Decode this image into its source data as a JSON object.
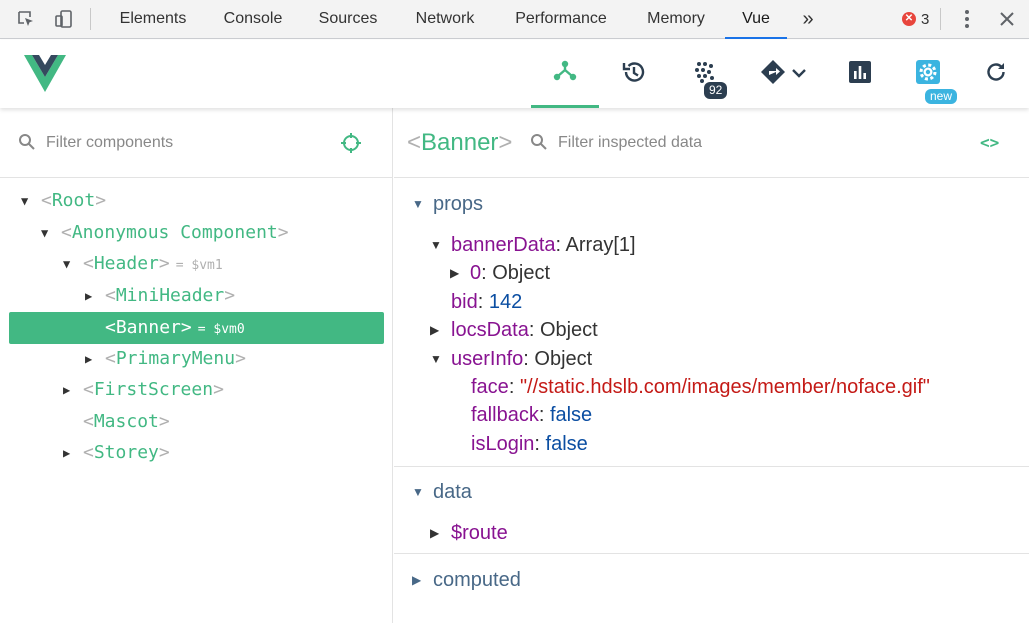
{
  "devtools": {
    "tabs": [
      "Elements",
      "Console",
      "Sources",
      "Network",
      "Performance",
      "Memory",
      "Vue"
    ],
    "more": "»",
    "error_count": "3",
    "accent": "#1a73e8"
  },
  "vue_toolbar": {
    "tools": [
      {
        "name": "components",
        "icon": "component-tree-icon",
        "active": true
      },
      {
        "name": "vuex",
        "icon": "history-icon"
      },
      {
        "name": "events",
        "icon": "events-dots-icon",
        "badge": "92"
      },
      {
        "name": "routing",
        "icon": "route-icon"
      },
      {
        "name": "performance",
        "icon": "bar-chart-icon"
      },
      {
        "name": "settings",
        "icon": "gear-icon",
        "badge": "new"
      },
      {
        "name": "refresh",
        "icon": "refresh-icon"
      }
    ],
    "events_badge": "92",
    "settings_badge": "new",
    "brand": "#42b883"
  },
  "components": {
    "filter_placeholder": "Filter components",
    "tree": [
      {
        "name": "Root",
        "expanded": true
      },
      {
        "name": "Anonymous Component",
        "expanded": true
      },
      {
        "name": "Header",
        "vm": "= $vm1",
        "expanded": true
      },
      {
        "name": "MiniHeader",
        "collapsed": true
      },
      {
        "name": "Banner",
        "vm": "= $vm0",
        "selected": true
      },
      {
        "name": "PrimaryMenu",
        "collapsed": true
      },
      {
        "name": "FirstScreen",
        "collapsed": true
      },
      {
        "name": "Mascot"
      },
      {
        "name": "Storey",
        "collapsed": true
      }
    ]
  },
  "inspector": {
    "component_name": "Banner",
    "filter_placeholder": "Filter inspected data",
    "code_icon": "<>",
    "sections": {
      "props": {
        "label": "props",
        "rows": {
          "bannerData": {
            "key": "bannerData",
            "value": "Array[1]"
          },
          "item0": {
            "key": "0",
            "value": "Object"
          },
          "bid": {
            "key": "bid",
            "value": "142"
          },
          "locsData": {
            "key": "locsData",
            "value": "Object"
          },
          "userInfo": {
            "key": "userInfo",
            "value": "Object"
          },
          "face": {
            "key": "face",
            "value": "\"//static.hdslb.com/images/member/noface.gif\""
          },
          "fallback": {
            "key": "fallback",
            "value": "false"
          },
          "isLogin": {
            "key": "isLogin",
            "value": "false"
          }
        }
      },
      "data": {
        "label": "data",
        "rows": {
          "route": {
            "key": "$route"
          }
        }
      },
      "computed": {
        "label": "computed"
      }
    }
  }
}
